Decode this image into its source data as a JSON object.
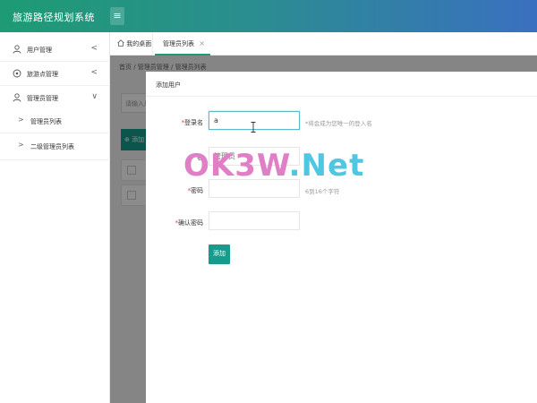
{
  "app": {
    "title": "旅游路径规划系统",
    "menu_icon": "hamburger-icon"
  },
  "sidebar": {
    "items": [
      {
        "label": "用户管理",
        "icon": "user-icon",
        "arrow": "<"
      },
      {
        "label": "旅游点管理",
        "icon": "location-icon",
        "arrow": "<"
      },
      {
        "label": "管理员管理",
        "icon": "user-icon",
        "arrow": "∨"
      }
    ],
    "subitems": [
      {
        "label": "管理员列表",
        "bullet": ">"
      },
      {
        "label": "二级管理员列表",
        "bullet": ">"
      }
    ]
  },
  "tabs": {
    "home": "我的桌面",
    "active": "管理员列表",
    "close": "×"
  },
  "background": {
    "breadcrumb": "首页 / 管理员管理 / 管理员列表",
    "search_placeholder": "请输入用",
    "add_label": "添加"
  },
  "modal": {
    "title": "添加用户",
    "fields": [
      {
        "label": "登录名",
        "value": "a",
        "placeholder": "",
        "hint": "*将会成为您唯一的登入名",
        "required": "*"
      },
      {
        "label": "名",
        "value": "",
        "placeholder": "管理员",
        "hint": "",
        "required": ""
      },
      {
        "label": "密码",
        "value": "",
        "placeholder": "",
        "hint": "6到16个字符",
        "required": "*"
      },
      {
        "label": "确认密码",
        "value": "",
        "placeholder": "",
        "hint": "",
        "required": "*"
      }
    ],
    "submit": "添加"
  },
  "watermark": {
    "part1": "OK3W",
    "part2": ".Net"
  }
}
